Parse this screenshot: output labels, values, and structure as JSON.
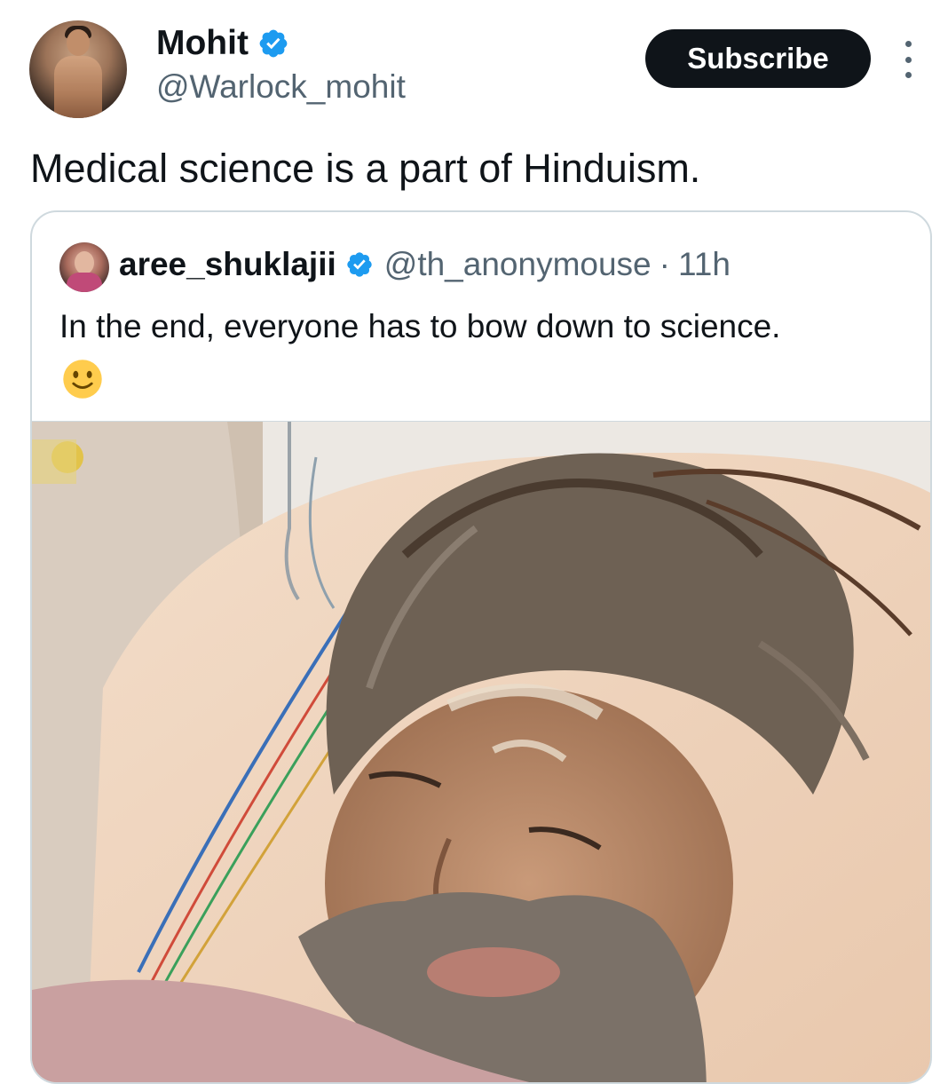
{
  "author": {
    "display_name": "Mohit",
    "handle": "@Warlock_mohit",
    "verified": true
  },
  "actions": {
    "subscribe_label": "Subscribe",
    "more_icon": "more-vertical-icon"
  },
  "tweet": {
    "text": "Medical science is a part of Hinduism."
  },
  "quoted_tweet": {
    "display_name": "aree_shuklajii",
    "handle": "@th_anonymouse",
    "separator": "·",
    "time": "11h",
    "verified": true,
    "text": "In the end, everyone has to bow down to science.",
    "emoji": "🙂"
  },
  "colors": {
    "verified_blue": "#1d9bf0",
    "subscribe_bg": "#0f1419",
    "secondary_text": "#536471",
    "border": "#cfd9de"
  }
}
